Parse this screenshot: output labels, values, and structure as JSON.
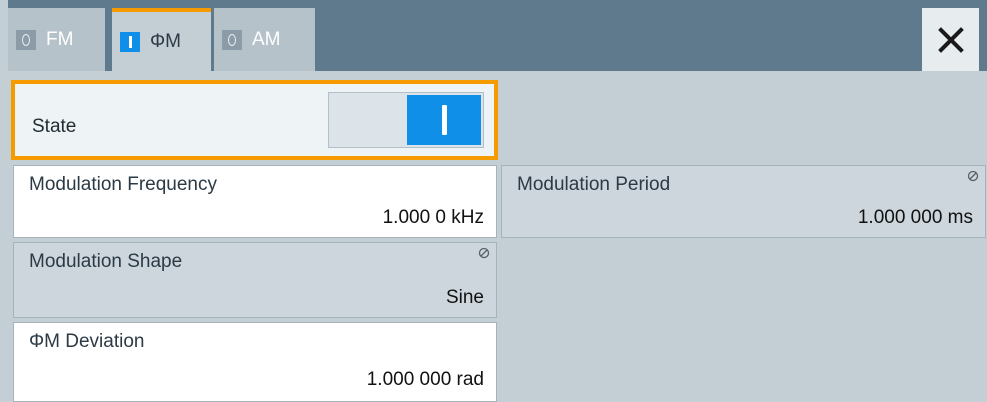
{
  "tabs": [
    {
      "label": "FM",
      "state": "off"
    },
    {
      "label": "ΦM",
      "state": "on"
    },
    {
      "label": "AM",
      "state": "off"
    }
  ],
  "active_tab": "ΦM",
  "state": {
    "label": "State",
    "value": "on"
  },
  "modulation_frequency": {
    "label": "Modulation Frequency",
    "value": "1.000 0 kHz"
  },
  "modulation_period": {
    "label": "Modulation Period",
    "value": "1.000 000 ms"
  },
  "modulation_shape": {
    "label": "Modulation Shape",
    "value": "Sine"
  },
  "phim_deviation": {
    "label": "ΦM Deviation",
    "value": "1.000 000 rad"
  },
  "colors": {
    "accent": "#f59b00",
    "active_blue": "#0f8fe8",
    "header": "#5f7a8c"
  },
  "icons": {
    "close": "close-icon",
    "readonly": "lock-icon"
  }
}
